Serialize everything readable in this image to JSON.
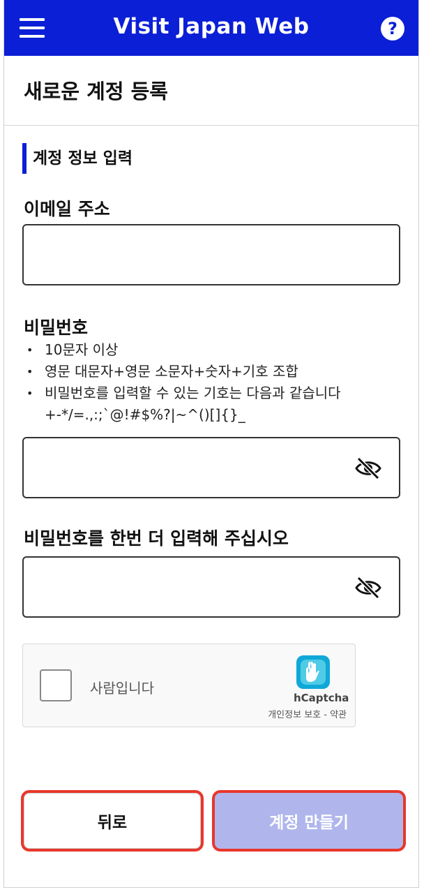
{
  "header": {
    "title": "Visit Japan Web",
    "menu_icon": "hamburger-menu-icon",
    "help_label": "?",
    "help_icon": "help-question-icon",
    "brand_color": "#0b1fd6"
  },
  "page": {
    "title": "새로운 계정 등록"
  },
  "section": {
    "title": "계정 정보 입력"
  },
  "email": {
    "label": "이메일 주소",
    "value": "",
    "placeholder": ""
  },
  "password": {
    "label": "비밀번호",
    "rules": [
      "10문자 이상",
      "영문 대문자+영문 소문자+숫자+기호 조합",
      "비밀번호를 입력할 수 있는 기호는 다음과 같습니다"
    ],
    "symbols": "+-*/=.,:;`@!#$%?|~^()[]{}_",
    "value": "",
    "placeholder": "",
    "toggle_icon": "eye-slash-icon"
  },
  "password_confirm": {
    "label": "비밀번호를 한번 더 입력해 주십시오",
    "value": "",
    "placeholder": "",
    "toggle_icon": "eye-slash-icon"
  },
  "captcha": {
    "label": "사람입니다",
    "brand": "hCaptcha",
    "links": "개인정보 보호 - 약관",
    "checked": false
  },
  "buttons": {
    "back_label": "뒤로",
    "create_label": "계정 만들기",
    "create_color": "#b0b6ec",
    "highlight_color": "#e8372b"
  }
}
